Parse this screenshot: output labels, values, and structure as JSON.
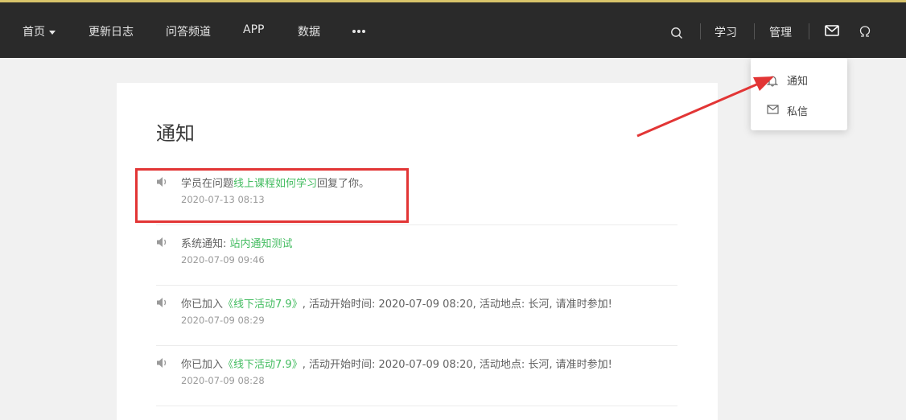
{
  "nav": {
    "home": "首页",
    "changelog": "更新日志",
    "qa": "问答频道",
    "app": "APP",
    "data": "数据",
    "study": "学习",
    "admin": "管理"
  },
  "page": {
    "title": "通知"
  },
  "notices": [
    {
      "prefix": "学员在问题",
      "link": "线上课程如何学习",
      "suffix": "回复了你。",
      "time": "2020-07-13 08:13"
    },
    {
      "prefix": "系统通知: ",
      "link": "站内通知测试",
      "suffix": "",
      "time": "2020-07-09 09:46"
    },
    {
      "prefix": "你已加入",
      "link": "《线下活动7.9》",
      "suffix": ", 活动开始时间: 2020-07-09 08:20, 活动地点: 长河, 请准时参加!",
      "time": "2020-07-09 08:29"
    },
    {
      "prefix": "你已加入",
      "link": "《线下活动7.9》",
      "suffix": ", 活动开始时间: 2020-07-09 08:20, 活动地点: 长河, 请准时参加!",
      "time": "2020-07-09 08:28"
    }
  ],
  "dropdown": {
    "notifications": "通知",
    "messages": "私信"
  },
  "colors": {
    "topbar": "#2a2a2a",
    "link": "#43bc60",
    "highlight": "#e23535"
  }
}
